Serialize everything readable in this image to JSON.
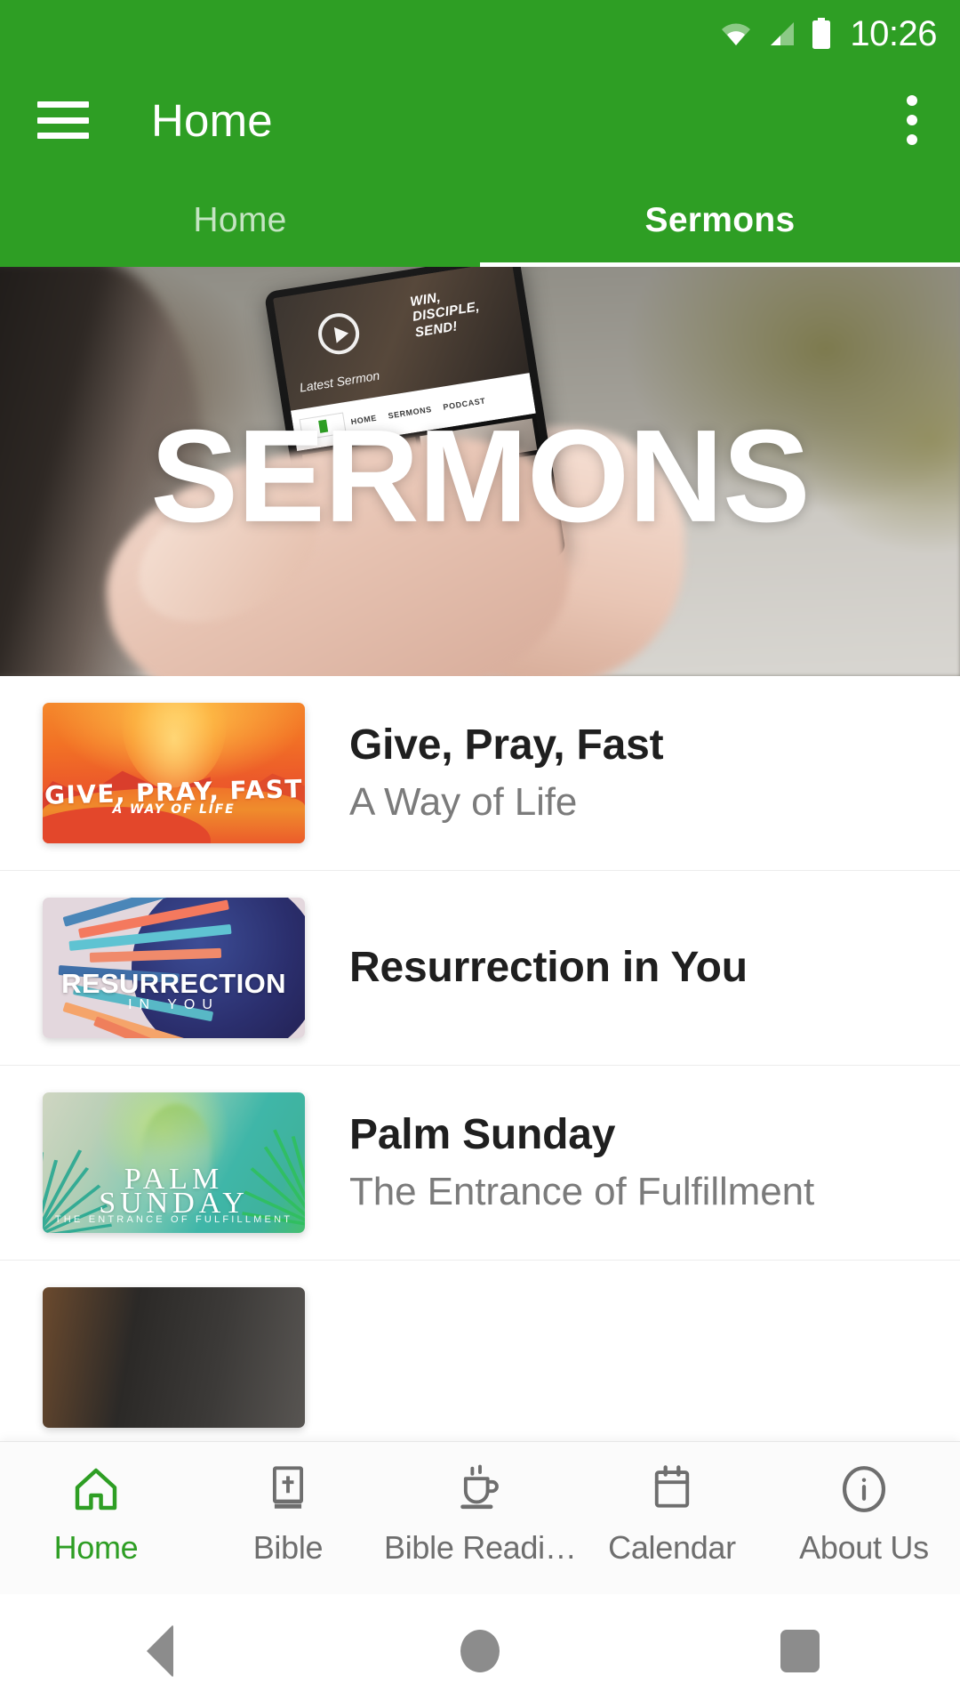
{
  "status_bar": {
    "time": "10:26",
    "icons": [
      "wifi-icon",
      "cellular-signal-icon",
      "battery-icon"
    ]
  },
  "app_bar": {
    "menu_icon": "hamburger-menu-icon",
    "title": "Home",
    "overflow_icon": "more-vertical-icon"
  },
  "tabs": {
    "items": [
      {
        "label": "Home",
        "active": false
      },
      {
        "label": "Sermons",
        "active": true
      }
    ]
  },
  "hero": {
    "title": "SERMONS",
    "image_alt": "hand-holding-phone-photo",
    "device_slogan": "WIN, DISCIPLE, SEND!",
    "device_latest": "Latest Sermon",
    "device_nav": [
      "HOME",
      "SERMONS",
      "PODCAST"
    ]
  },
  "sermons": [
    {
      "title": "Give, Pray, Fast",
      "subtitle": "A Way of Life",
      "thumb": {
        "style": "give-pray-fast",
        "line1": "GIVE, PRAY, FAST",
        "line2": "A WAY OF LIFE",
        "colors": [
          "#f4882c",
          "#e8492f",
          "#ffc24a"
        ]
      }
    },
    {
      "title": "Resurrection in You",
      "subtitle": "",
      "thumb": {
        "style": "resurrection",
        "line1": "RESURRECTION",
        "line2": "IN YOU",
        "colors": [
          "#e3d7dd",
          "#2b2f6e",
          "#f4795e",
          "#4ea8c8"
        ]
      }
    },
    {
      "title": "Palm Sunday",
      "subtitle": "The Entrance of Fulfillment",
      "thumb": {
        "style": "palm-sunday",
        "line1": "PALM",
        "line2": "SUNDAY",
        "line3": "THE ENTRANCE OF FULFILLMENT",
        "colors": [
          "#3fb6a8",
          "#45c06e",
          "#cfd6c2"
        ]
      }
    },
    {
      "title": "",
      "subtitle": "",
      "thumb": {
        "style": "next-partial",
        "line1": "",
        "line2": "",
        "colors": [
          "#2b2927"
        ]
      }
    }
  ],
  "bottom_nav": {
    "items": [
      {
        "label": "Home",
        "icon": "home-icon",
        "active": true
      },
      {
        "label": "Bible",
        "icon": "bible-book-icon",
        "active": false
      },
      {
        "label": "Bible Readi…",
        "icon": "coffee-cup-icon",
        "active": false
      },
      {
        "label": "Calendar",
        "icon": "calendar-icon",
        "active": false
      },
      {
        "label": "About Us",
        "icon": "info-circle-icon",
        "active": false
      }
    ],
    "active_color": "#2E9E24",
    "inactive_color": "#6e6e6e"
  },
  "system_nav": {
    "back": "back-triangle-icon",
    "home": "home-circle-icon",
    "recents": "recents-square-icon"
  },
  "theme": {
    "primary": "#2E9E24",
    "on_primary": "#ffffff",
    "surface": "#ffffff",
    "text_primary": "#1f1f1f",
    "text_secondary": "#7b7b7b"
  }
}
